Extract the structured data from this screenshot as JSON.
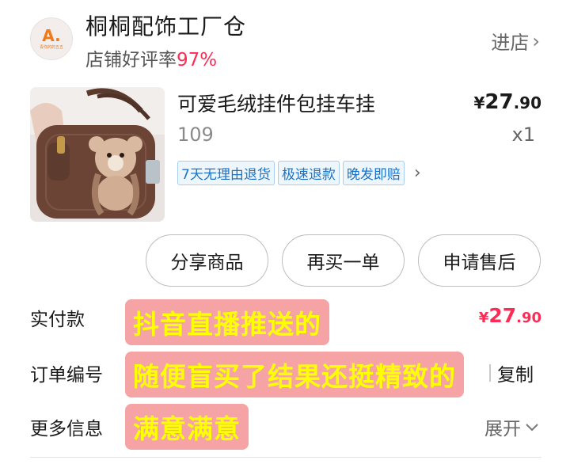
{
  "store": {
    "logo_mark": "A.",
    "logo_sub": "青你的的五五",
    "name": "桐桐配饰工厂仓",
    "rating_label": "店铺好评率",
    "rating_value": "97%",
    "enter_label": "进店"
  },
  "product": {
    "title": "可爱毛绒挂件包挂车挂",
    "currency": "¥",
    "price_int": "27",
    "price_dec": ".90",
    "sku": "109",
    "quantity": "x1",
    "service_tags": [
      "7天无理由退货",
      "极速退款",
      "晚发即赔"
    ]
  },
  "actions": {
    "share": "分享商品",
    "rebuy": "再买一单",
    "after_sale": "申请售后"
  },
  "order": {
    "paid_label": "实付款",
    "paid_currency": "¥",
    "paid_int": "27",
    "paid_dec": ".90",
    "order_no_label": "订单编号",
    "copy_label": "复制",
    "more_info_label": "更多信息",
    "expand_label": "展开"
  },
  "stickers": {
    "line1": "抖音直播推送的",
    "line2": "随便盲买了结果还挺精致的",
    "line3": "满意满意"
  },
  "colors": {
    "accent_red": "#fe2c55",
    "tag_blue": "#1a73c7",
    "sticker_bg": "#f6a3a6",
    "sticker_text": "#ffff00"
  }
}
